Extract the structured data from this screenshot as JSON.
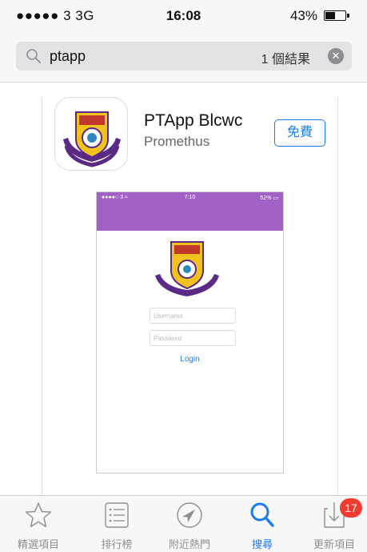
{
  "status": {
    "carrier": "●●●●● 3  3G",
    "time": "16:08",
    "battery": "43%"
  },
  "search": {
    "query": "ptapp",
    "result_count": "1 個結果"
  },
  "app": {
    "name": "PTApp Blcwc",
    "developer": "Promethus",
    "price_button": "免費"
  },
  "screenshot": {
    "carrier": "●●●●○ 3 ≈",
    "time": "7:10",
    "battery": "52% ▭",
    "username_placeholder": "Username",
    "password_placeholder": "Password",
    "login_label": "Login"
  },
  "tabbar": {
    "tabs": [
      {
        "label": "精選項目",
        "icon": "star-icon"
      },
      {
        "label": "排行榜",
        "icon": "list-icon"
      },
      {
        "label": "附近熱門",
        "icon": "location-icon"
      },
      {
        "label": "搜尋",
        "icon": "search-icon"
      },
      {
        "label": "更新項目",
        "icon": "download-icon"
      }
    ],
    "updates_badge": "17",
    "active": "搜尋"
  },
  "colors": {
    "accent": "#1a7cf0",
    "badge": "#f23b30",
    "screenshot_header": "#a261c4"
  }
}
